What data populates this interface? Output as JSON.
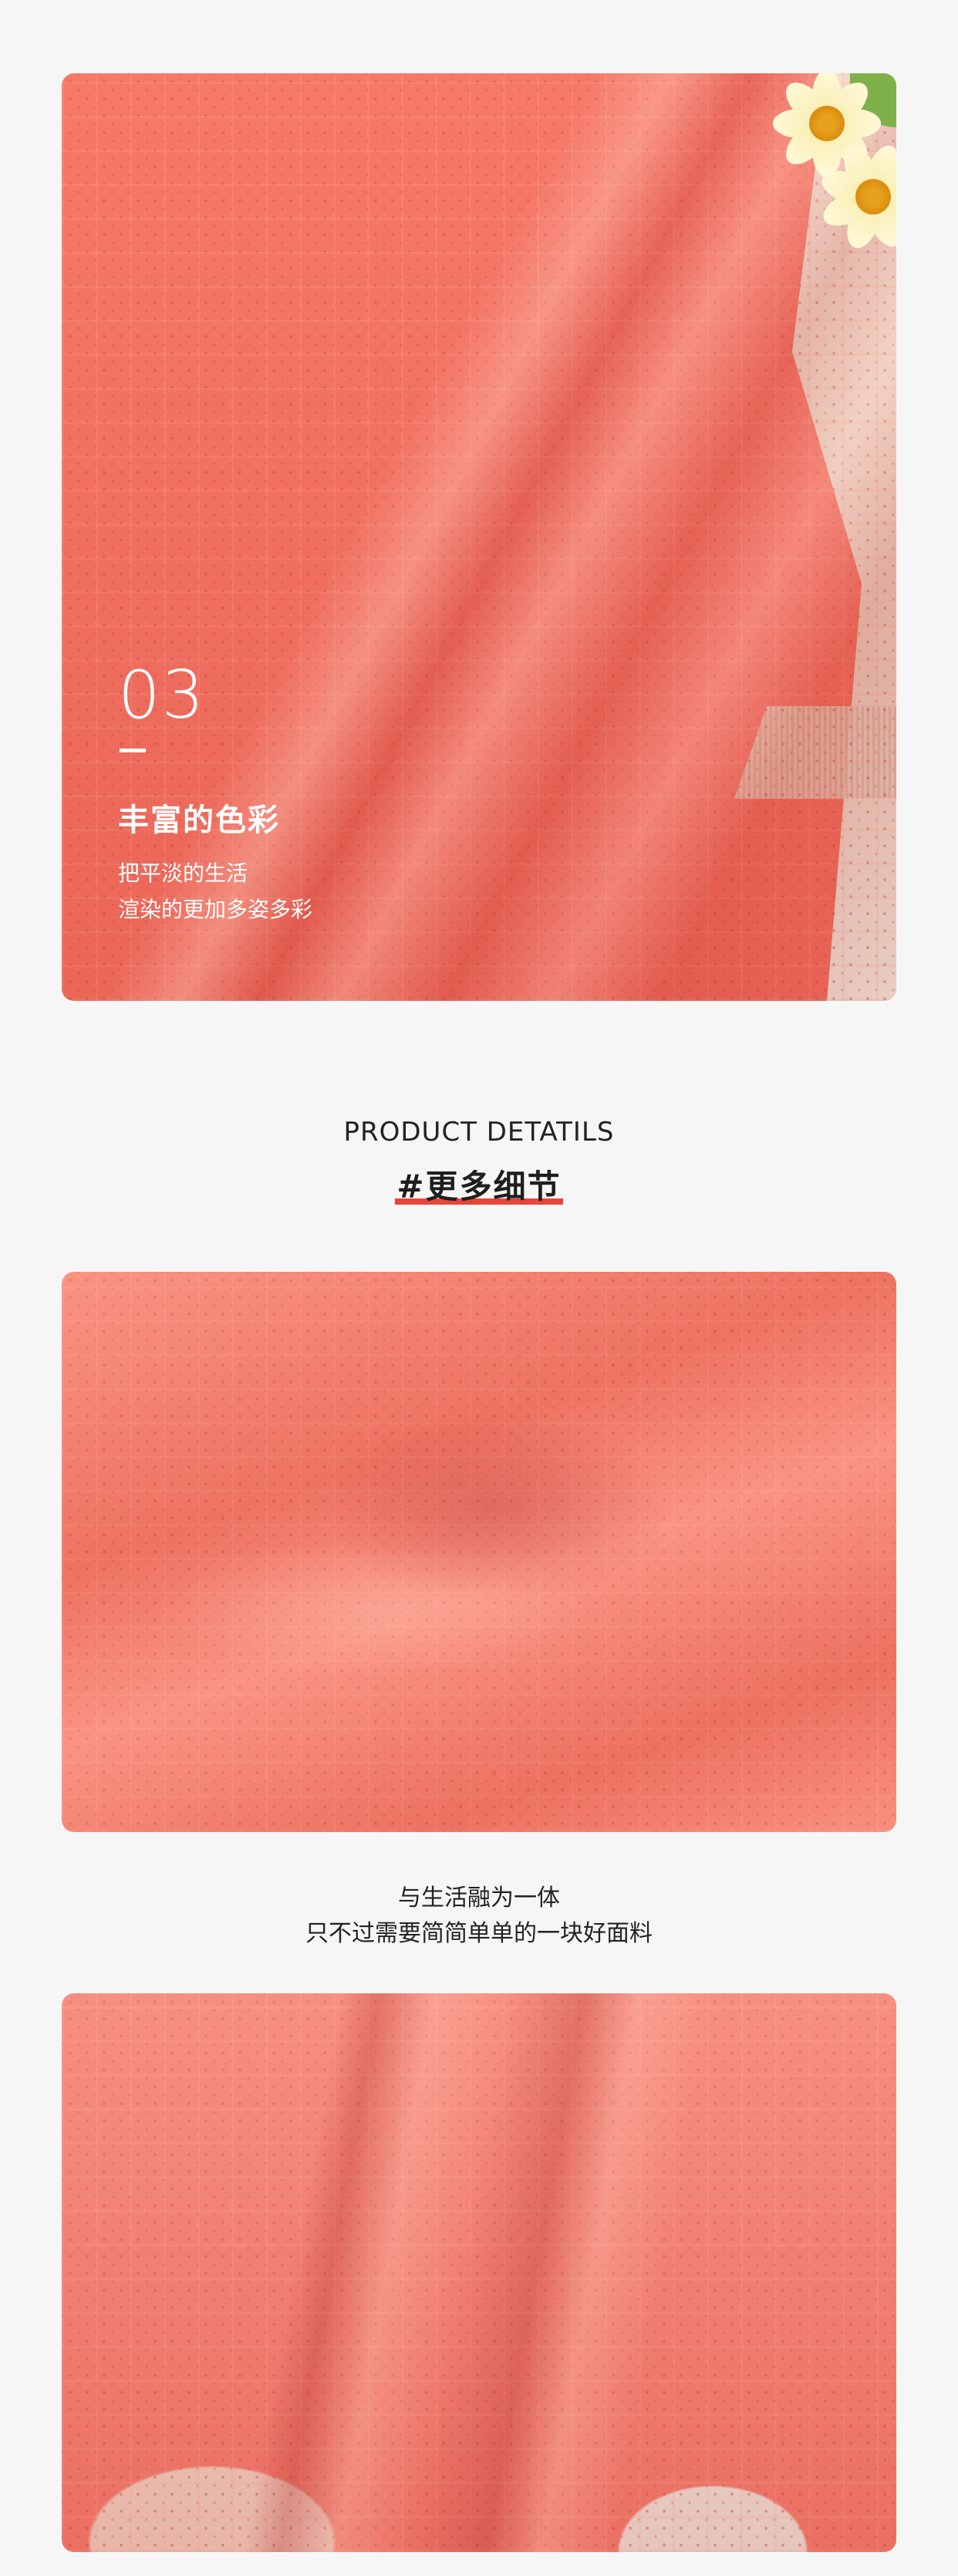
{
  "section1": {
    "number": "03",
    "title": "丰富的色彩",
    "line1": "把平淡的生活",
    "line2": "渲染的更加多姿多彩"
  },
  "heading": {
    "english": "PRODUCT  DETATILS",
    "chinese": "#更多细节"
  },
  "caption": {
    "line1": "与生活融为一体",
    "line2": "只不过需要简简单单的一块好面料"
  },
  "colors": {
    "fabric": "#f6705f",
    "accent_underline": "#e8453c",
    "background": "#f6f6f6"
  }
}
